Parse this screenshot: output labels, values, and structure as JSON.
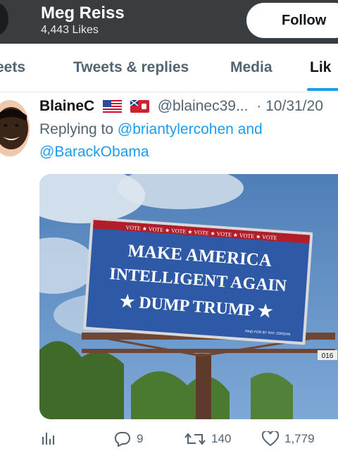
{
  "header": {
    "title": "Meg Reiss",
    "likes": "4,443 Likes",
    "follow_label": "Follow"
  },
  "tabs": [
    "eets",
    "Tweets & replies",
    "Media",
    "Lik"
  ],
  "tweet": {
    "name": "BlaineC",
    "handle": "@blainec39...",
    "date": "· 10/31/20",
    "replying_prefix": "Replying to",
    "replying_user1": "@briantylercohen",
    "replying_and": " and",
    "replying_user2": "@BarackObama",
    "image": {
      "vote_strip": "VOTE ★ VOTE ★ VOTE ★ VOTE ★ VOTE ★ VOTE ★ VOTE",
      "line1": "MAKE AMERICA",
      "line2": "INTELLIGENT AGAIN",
      "line3": "★ DUMP TRUMP ★",
      "paid_by": "PAID FOR BY RAY JORDAN",
      "panel_number": "016"
    },
    "stats": {
      "replies": "9",
      "retweets": "140",
      "likes": "1,779"
    }
  },
  "colors": {
    "accent": "#1d9bf0",
    "muted": "#536471",
    "billboard_blue": "#2e59a6",
    "billboard_red": "#b21d2a"
  }
}
